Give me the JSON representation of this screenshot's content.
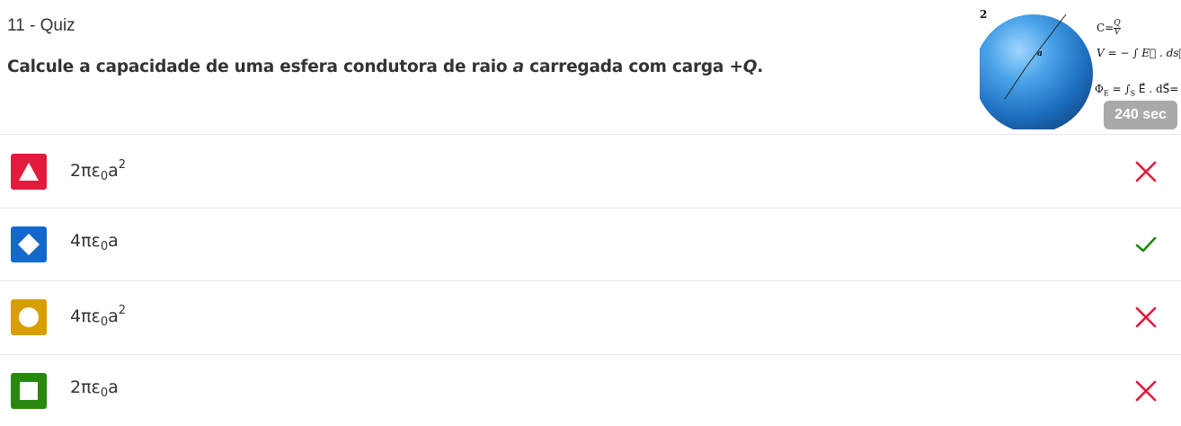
{
  "quiz": {
    "number_label": "11 - Quiz",
    "question_prefix": "Calcule a capacidade de uma esfera condutora de raio ",
    "question_var_a": "a",
    "question_mid": " carregada com carga ",
    "question_charge": "+Q",
    "question_suffix": ".",
    "timer": "240 sec"
  },
  "image": {
    "corner_label": "2",
    "radius_label": "a",
    "formula_c": "C= Q / V",
    "formula_v": "V = − ∫ E⃗ . ds⃗",
    "formula_phi": "Φ_E = ∫_S E⃗ . dS⃗ ="
  },
  "options": [
    {
      "shape": "triangle",
      "color": "#e21b3c",
      "pre": "2πε",
      "sub": "0",
      "post": "a",
      "sup": "2",
      "status": "incorrect"
    },
    {
      "shape": "diamond",
      "color": "#1368ce",
      "pre": "4πε",
      "sub": "0",
      "post": "a",
      "sup": "",
      "status": "correct"
    },
    {
      "shape": "circle",
      "color": "#d89e00",
      "pre": "4πε",
      "sub": "0",
      "post": "a",
      "sup": "2",
      "status": "incorrect"
    },
    {
      "shape": "square",
      "color": "#26890c",
      "pre": "2πε",
      "sub": "0",
      "post": "a",
      "sup": "",
      "status": "incorrect"
    }
  ],
  "colors": {
    "incorrect": "#e21b3c",
    "correct": "#26890c"
  }
}
